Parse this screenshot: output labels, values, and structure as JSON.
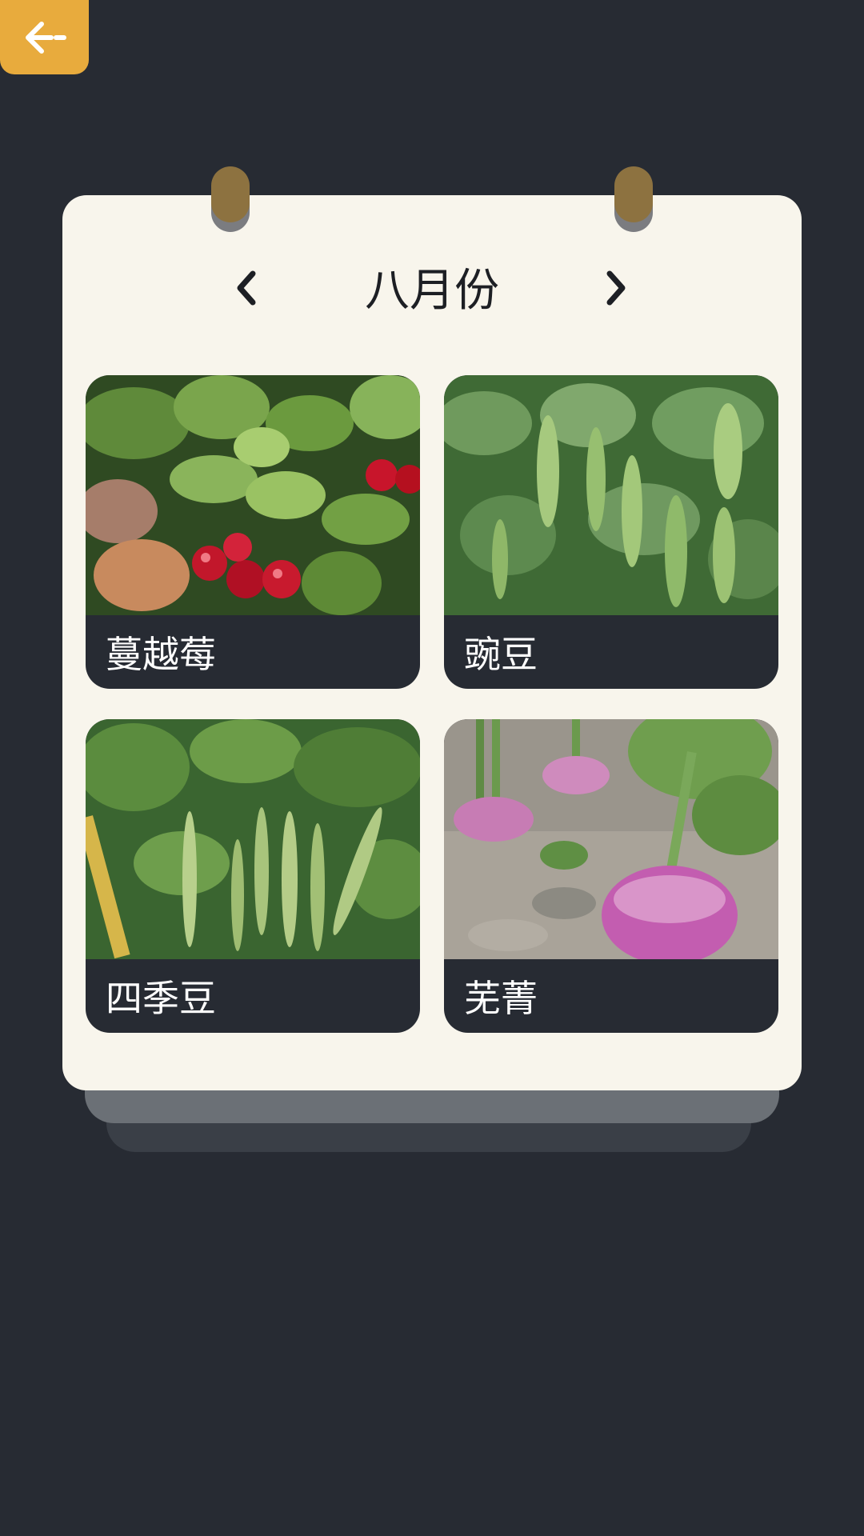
{
  "header": {
    "back_icon": "back-arrow-icon"
  },
  "calendar": {
    "month_title": "八月份",
    "prev_icon": "chevron-left-icon",
    "next_icon": "chevron-right-icon",
    "items": [
      {
        "label": "蔓越莓",
        "image": "cranberry-photo"
      },
      {
        "label": "豌豆",
        "image": "pea-pods-photo"
      },
      {
        "label": "四季豆",
        "image": "green-beans-photo"
      },
      {
        "label": "芜菁",
        "image": "turnip-photo"
      }
    ]
  },
  "colors": {
    "background": "#272b33",
    "card": "#f8f5ec",
    "accent": "#e8ab3d",
    "ring": "#8d7240"
  }
}
